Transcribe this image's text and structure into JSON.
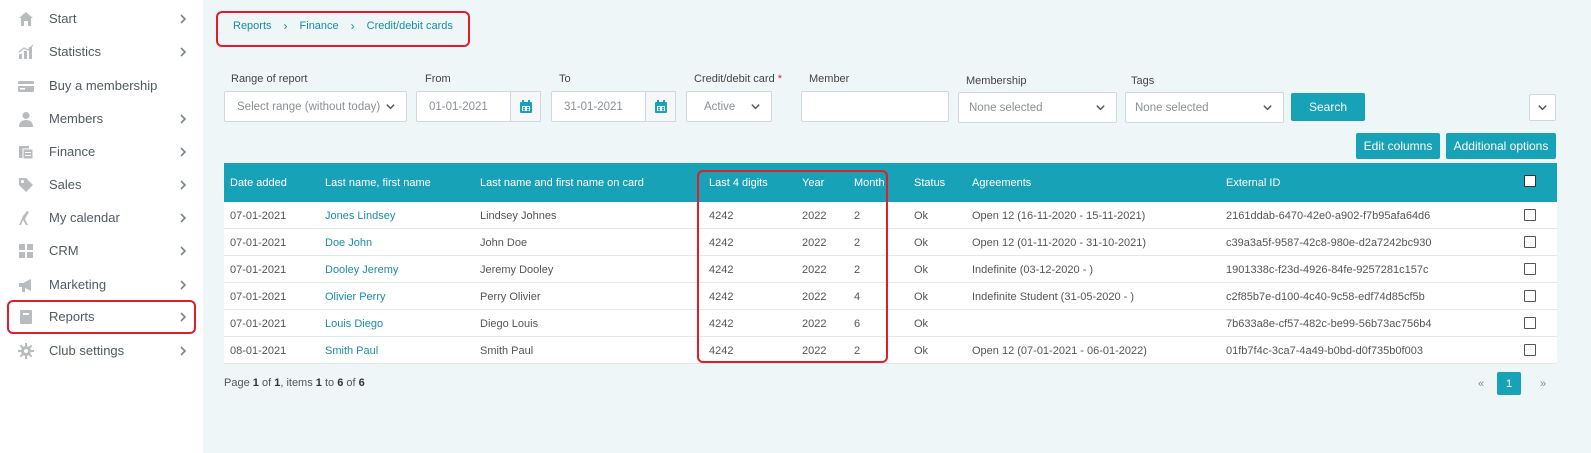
{
  "sidebar": {
    "items": [
      {
        "label": "Start",
        "icon": "home-icon",
        "chevron": true
      },
      {
        "label": "Statistics",
        "icon": "chart-icon",
        "chevron": true
      },
      {
        "label": "Buy a membership",
        "icon": "card-icon",
        "chevron": false
      },
      {
        "label": "Members",
        "icon": "user-icon",
        "chevron": true
      },
      {
        "label": "Finance",
        "icon": "finance-icon",
        "chevron": true
      },
      {
        "label": "Sales",
        "icon": "tag-icon",
        "chevron": true
      },
      {
        "label": "My calendar",
        "icon": "runner-icon",
        "chevron": true
      },
      {
        "label": "CRM",
        "icon": "grid-icon",
        "chevron": true
      },
      {
        "label": "Marketing",
        "icon": "megaphone-icon",
        "chevron": true
      },
      {
        "label": "Reports",
        "icon": "book-icon",
        "chevron": true
      },
      {
        "label": "Club settings",
        "icon": "gear-icon",
        "chevron": true
      }
    ]
  },
  "breadcrumb": [
    "Reports",
    "Finance",
    "Credit/debit cards"
  ],
  "filters": {
    "range_label": "Range of report",
    "range_value": "Select range (without today)",
    "from_label": "From",
    "from_value": "01-01-2021",
    "to_label": "To",
    "to_value": "31-01-2021",
    "card_label": "Credit/debit card",
    "card_required": "*",
    "card_value": "Active",
    "member_label": "Member",
    "member_value": "",
    "membership_label": "Membership",
    "membership_value": "None selected",
    "tags_label": "Tags",
    "tags_value": "None selected",
    "search_button": "Search"
  },
  "actions": {
    "edit_columns": "Edit columns",
    "additional_options": "Additional options"
  },
  "table": {
    "headers": [
      "Date added",
      "Last name, first name",
      "Last name and first name on card",
      "Last 4 digits",
      "Year",
      "Month",
      "Status",
      "Agreements",
      "External ID"
    ],
    "rows": [
      [
        "07-01-2021",
        "Jones Lindsey",
        "Lindsey Johnes",
        "4242",
        "2022",
        "2",
        "Ok",
        "Open 12 (16-11-2020 - 15-11-2021)",
        "2161ddab-6470-42e0-a902-f7b95afa64d6"
      ],
      [
        "07-01-2021",
        "Doe John",
        "John Doe",
        "4242",
        "2022",
        "2",
        "Ok",
        "Open 12 (01-11-2020 - 31-10-2021)",
        "c39a3a5f-9587-42c8-980e-d2a7242bc930"
      ],
      [
        "07-01-2021",
        "Dooley Jeremy",
        "Jeremy Dooley",
        "4242",
        "2022",
        "2",
        "Ok",
        "Indefinite (03-12-2020 - )",
        "1901338c-f23d-4926-84fe-9257281c157c"
      ],
      [
        "07-01-2021",
        "Olivier Perry",
        "Perry Olivier",
        "4242",
        "2022",
        "4",
        "Ok",
        "Indefinite Student (31-05-2020 - )",
        "c2f85b7e-d100-4c40-9c58-edf74d85cf5b"
      ],
      [
        "07-01-2021",
        "Louis Diego",
        "Diego Louis",
        "4242",
        "2022",
        "6",
        "Ok",
        "",
        "7b633a8e-cf57-482c-be99-56b73ac756b4"
      ],
      [
        "08-01-2021",
        "Smith Paul",
        "Smith Paul",
        "4242",
        "2022",
        "2",
        "Ok",
        "Open 12 (07-01-2021 - 06-01-2022)",
        "01fb7f4c-3ca7-4a49-b0bd-d0f735b0f003"
      ]
    ]
  },
  "paging": {
    "page_word": "Page",
    "page": "1",
    "of_word": "of",
    "pages": "1",
    "items_word": ", items",
    "from": "1",
    "to_word": "to",
    "to": "6",
    "of2_word": "of",
    "total": "6",
    "prev": "«",
    "current": "1",
    "next": "»"
  },
  "colors": {
    "accent": "#17a2b8",
    "highlight": "#e21c2a",
    "background": "#eef6f7"
  }
}
